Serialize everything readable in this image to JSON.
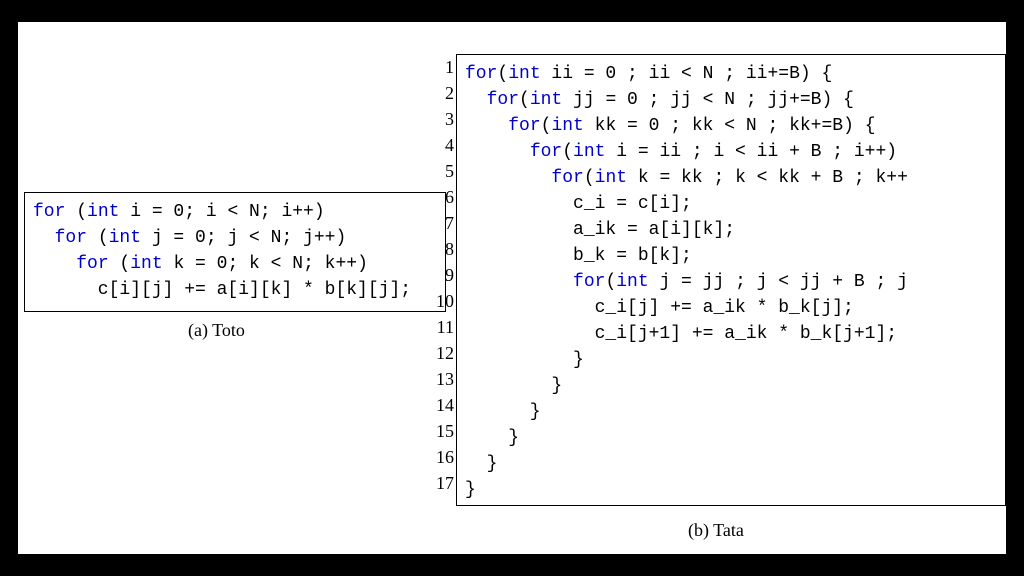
{
  "figure": {
    "caption_a": "(a) Toto",
    "caption_b": "(b) Tata"
  },
  "code_a": {
    "tokens": [
      [
        {
          "t": "for",
          "k": true
        },
        {
          "t": " (",
          "k": false
        },
        {
          "t": "int",
          "k": true
        },
        {
          "t": " i = 0; i < N; i++)",
          "k": false
        }
      ],
      [
        {
          "t": "  ",
          "k": false
        },
        {
          "t": "for",
          "k": true
        },
        {
          "t": " (",
          "k": false
        },
        {
          "t": "int",
          "k": true
        },
        {
          "t": " j = 0; j < N; j++)",
          "k": false
        }
      ],
      [
        {
          "t": "    ",
          "k": false
        },
        {
          "t": "for",
          "k": true
        },
        {
          "t": " (",
          "k": false
        },
        {
          "t": "int",
          "k": true
        },
        {
          "t": " k = 0; k < N; k++)",
          "k": false
        }
      ],
      [
        {
          "t": "      c[i][j] += a[i][k] * b[k][j];",
          "k": false
        }
      ]
    ]
  },
  "code_b": {
    "line_numbers": [
      "1",
      "2",
      "3",
      "4",
      "5",
      "6",
      "7",
      "8",
      "9",
      "10",
      "11",
      "12",
      "13",
      "14",
      "15",
      "16",
      "17"
    ],
    "tokens": [
      [
        {
          "t": "for",
          "k": true
        },
        {
          "t": "(",
          "k": false
        },
        {
          "t": "int",
          "k": true
        },
        {
          "t": " ii = 0 ; ii < N ; ii+=B) {",
          "k": false
        }
      ],
      [
        {
          "t": "  ",
          "k": false
        },
        {
          "t": "for",
          "k": true
        },
        {
          "t": "(",
          "k": false
        },
        {
          "t": "int",
          "k": true
        },
        {
          "t": " jj = 0 ; jj < N ; jj+=B) {",
          "k": false
        }
      ],
      [
        {
          "t": "    ",
          "k": false
        },
        {
          "t": "for",
          "k": true
        },
        {
          "t": "(",
          "k": false
        },
        {
          "t": "int",
          "k": true
        },
        {
          "t": " kk = 0 ; kk < N ; kk+=B) {",
          "k": false
        }
      ],
      [
        {
          "t": "      ",
          "k": false
        },
        {
          "t": "for",
          "k": true
        },
        {
          "t": "(",
          "k": false
        },
        {
          "t": "int",
          "k": true
        },
        {
          "t": " i = ii ; i < ii + B ; i++)",
          "k": false
        }
      ],
      [
        {
          "t": "        ",
          "k": false
        },
        {
          "t": "for",
          "k": true
        },
        {
          "t": "(",
          "k": false
        },
        {
          "t": "int",
          "k": true
        },
        {
          "t": " k = kk ; k < kk + B ; k++",
          "k": false
        }
      ],
      [
        {
          "t": "          c_i = c[i];",
          "k": false
        }
      ],
      [
        {
          "t": "          a_ik = a[i][k];",
          "k": false
        }
      ],
      [
        {
          "t": "          b_k = b[k];",
          "k": false
        }
      ],
      [
        {
          "t": "          ",
          "k": false
        },
        {
          "t": "for",
          "k": true
        },
        {
          "t": "(",
          "k": false
        },
        {
          "t": "int",
          "k": true
        },
        {
          "t": " j = jj ; j < jj + B ; j",
          "k": false
        }
      ],
      [
        {
          "t": "            c_i[j] += a_ik * b_k[j];",
          "k": false
        }
      ],
      [
        {
          "t": "            c_i[j+1] += a_ik * b_k[j+1];",
          "k": false
        }
      ],
      [
        {
          "t": "          }",
          "k": false
        }
      ],
      [
        {
          "t": "        }",
          "k": false
        }
      ],
      [
        {
          "t": "      }",
          "k": false
        }
      ],
      [
        {
          "t": "    }",
          "k": false
        }
      ],
      [
        {
          "t": "  }",
          "k": false
        }
      ],
      [
        {
          "t": "}",
          "k": false
        }
      ]
    ]
  }
}
